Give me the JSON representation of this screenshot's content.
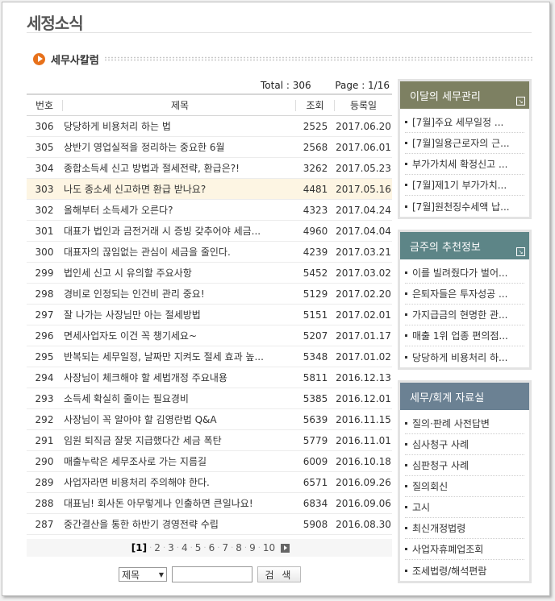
{
  "page_title": "세정소식",
  "section_title": "세무사칼럼",
  "meta": {
    "total": "Total : 306",
    "page": "Page : 1/16"
  },
  "list_header": {
    "no": "번호",
    "title": "제목",
    "views": "조회",
    "date": "등록일"
  },
  "rows": [
    {
      "no": "306",
      "title": "당당하게 비용처리 하는 법",
      "views": "2525",
      "date": "2017.06.20"
    },
    {
      "no": "305",
      "title": "상반기 영업실적을 정리하는 중요한 6월",
      "views": "2568",
      "date": "2017.06.01"
    },
    {
      "no": "304",
      "title": "종합소득세 신고 방법과 절세전략, 환급은?!",
      "views": "3262",
      "date": "2017.05.23"
    },
    {
      "no": "303",
      "title": "나도 종소세 신고하면 환급 받나요?",
      "views": "4481",
      "date": "2017.05.16"
    },
    {
      "no": "302",
      "title": "올해부터 소득세가 오른다?",
      "views": "4323",
      "date": "2017.04.24"
    },
    {
      "no": "301",
      "title": "대표가 법인과 금전거래 시 증빙 갖추어야 세금...",
      "views": "4960",
      "date": "2017.04.04"
    },
    {
      "no": "300",
      "title": "대표자의 끊임없는 관심이 세금을 줄인다.",
      "views": "4239",
      "date": "2017.03.21"
    },
    {
      "no": "299",
      "title": "법인세 신고 시 유의할 주요사항",
      "views": "5452",
      "date": "2017.03.02"
    },
    {
      "no": "298",
      "title": "경비로 인정되는 인건비 관리 중요!",
      "views": "5129",
      "date": "2017.02.20"
    },
    {
      "no": "297",
      "title": "잘 나가는 사장님만 아는 절세방법",
      "views": "5151",
      "date": "2017.02.01"
    },
    {
      "no": "296",
      "title": "면세사업자도 이건 꼭 챙기세요~",
      "views": "5207",
      "date": "2017.01.17"
    },
    {
      "no": "295",
      "title": "반복되는 세무일정, 날짜만 지켜도 절세 효과 높...",
      "views": "5348",
      "date": "2017.01.02"
    },
    {
      "no": "294",
      "title": "사장님이 체크해야 할 세법개정 주요내용",
      "views": "5811",
      "date": "2016.12.13"
    },
    {
      "no": "293",
      "title": "소득세 확실히 줄이는 필요경비",
      "views": "5385",
      "date": "2016.12.01"
    },
    {
      "no": "292",
      "title": "사장님이 꼭 알아야 할 김영란법 Q&A",
      "views": "5639",
      "date": "2016.11.15"
    },
    {
      "no": "291",
      "title": "임원 퇴직금 잘못 지급했다간 세금 폭탄",
      "views": "5779",
      "date": "2016.11.01"
    },
    {
      "no": "290",
      "title": "매출누락은 세무조사로 가는 지름길",
      "views": "6009",
      "date": "2016.10.18"
    },
    {
      "no": "289",
      "title": "사업자라면 비용처리 주의해야 한다.",
      "views": "6571",
      "date": "2016.09.26"
    },
    {
      "no": "288",
      "title": "대표님! 회사돈 아무렇게나 인출하면 큰일나요!",
      "views": "6834",
      "date": "2016.09.06"
    },
    {
      "no": "287",
      "title": "중간결산을 통한 하반기 경영전략 수립",
      "views": "5908",
      "date": "2016.08.30"
    }
  ],
  "pager": {
    "pages": [
      "[1]",
      "2",
      "3",
      "4",
      "5",
      "6",
      "7",
      "8",
      "9",
      "10"
    ]
  },
  "search": {
    "select_value": "제목",
    "button_label": "검 색"
  },
  "boxes": [
    {
      "title": "이달의 세무관리",
      "color": "#7d8062",
      "items": [
        "[7월]주요 세무일정 ...",
        "[7월]일용근로자의 근...",
        "부가가치세 확정신고 ...",
        "[7월]제1기 부가가치...",
        "[7월]원천징수세액 납..."
      ]
    },
    {
      "title": "금주의 추천정보",
      "color": "#5d8587",
      "items": [
        "이를 빌려줬다가 벌어...",
        "은퇴자들은 투자성공 ...",
        "가지급금의 현명한 관...",
        "매출 1위 업종 편의점...",
        "당당하게 비용처리 하..."
      ]
    },
    {
      "title": "세무/회계 자료실",
      "color": "#6b8193",
      "items": [
        "질의·판례 사전답변",
        "심사청구 사례",
        "심판청구 사례",
        "질의회신",
        "고시",
        "최신개정법령",
        "사업자휴폐업조회",
        "조세법령/해석편람"
      ]
    }
  ]
}
